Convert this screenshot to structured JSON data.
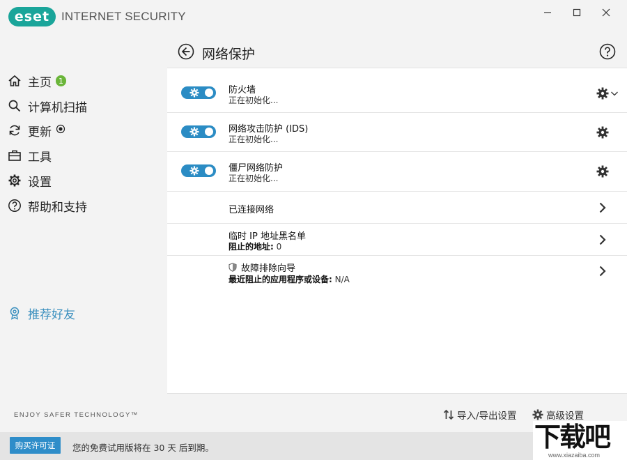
{
  "app": {
    "logo": "eset",
    "product_name": "INTERNET SECURITY",
    "brand_color": "#1aa59a",
    "accent_color": "#2b8cc4"
  },
  "window_controls": [
    "minimize",
    "maximize",
    "close"
  ],
  "sidebar": {
    "items": [
      {
        "label": "主页",
        "icon": "home-icon",
        "badge": "1"
      },
      {
        "label": "计算机扫描",
        "icon": "search-icon"
      },
      {
        "label": "更新",
        "icon": "refresh-icon"
      },
      {
        "label": "工具",
        "icon": "toolbox-icon"
      },
      {
        "label": "设置",
        "icon": "gear-icon"
      },
      {
        "label": "帮助和支持",
        "icon": "help-icon"
      }
    ],
    "refer_friend": "推荐好友",
    "tagline": "ENJOY SAFER TECHNOLOGY™"
  },
  "header": {
    "title": "网络保护"
  },
  "rows": [
    {
      "title": "防火墙",
      "status": "正在初始化..."
    },
    {
      "title": "网络攻击防护 (IDS)",
      "status": "正在初始化..."
    },
    {
      "title": "僵尸网络防护",
      "status": "正在初始化..."
    }
  ],
  "links": [
    {
      "title": "已连接网络"
    },
    {
      "title": "临时 IP 地址黑名单",
      "detail_label": "阻止的地址:",
      "detail_value": "0"
    },
    {
      "title": "故障排除向导",
      "detail_label": "最近阻止的应用程序或设备:",
      "detail_value": "N/A"
    }
  ],
  "footer": {
    "import_export": "导入/导出设置",
    "advanced": "高级设置"
  },
  "statusbar": {
    "buy_button": "购买许可证",
    "trial_text": "您的免费试用版将在 30 天 后到期。"
  },
  "watermark": {
    "main": "下载吧",
    "sub": "www.xiazaiba.com"
  }
}
